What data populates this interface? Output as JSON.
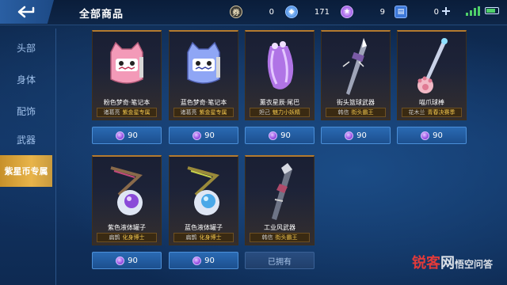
{
  "header": {
    "title": "全部商品",
    "currencies": [
      {
        "name": "coupon",
        "icon": "ticket-icon",
        "value": "0",
        "color": "#d9c8a0"
      },
      {
        "name": "diamond",
        "icon": "diamond-icon",
        "value": "171",
        "color": "#6aa8ff"
      },
      {
        "name": "purple-star",
        "icon": "purple-star-coin-icon",
        "value": "9",
        "color": "#b56dff"
      },
      {
        "name": "voucher",
        "icon": "voucher-icon",
        "value": "0",
        "color": "#4f8ef0"
      }
    ]
  },
  "sidebar": {
    "items": [
      {
        "label": "头部",
        "active": false
      },
      {
        "label": "身体",
        "active": false
      },
      {
        "label": "配饰",
        "active": false
      },
      {
        "label": "武器",
        "active": false
      },
      {
        "label": "紫星币专属",
        "active": true
      }
    ]
  },
  "products": [
    {
      "name": "粉色梦奇·笔记本",
      "hero": "诸葛亮",
      "tag": "紫金星专属",
      "price": "90",
      "owned": false,
      "art": "pink-notebook"
    },
    {
      "name": "蓝色梦奇·笔记本",
      "hero": "诸葛亮",
      "tag": "紫金星专属",
      "price": "90",
      "owned": false,
      "art": "blue-notebook"
    },
    {
      "name": "薰衣星辰·尾巴",
      "hero": "妲己",
      "tag": "魅力小妖精",
      "price": "90",
      "owned": false,
      "art": "lavender-tail"
    },
    {
      "name": "街头篮球武器",
      "hero": "韩信",
      "tag": "街头霸王",
      "price": "90",
      "owned": false,
      "art": "street-spear"
    },
    {
      "name": "喵爪球棒",
      "hero": "花木兰",
      "tag": "青春决赛季",
      "price": "90",
      "owned": false,
      "art": "cat-paw-bat"
    },
    {
      "name": "紫色液体罐子",
      "hero": "扁鹊",
      "tag": "化身博士",
      "price": "90",
      "owned": false,
      "art": "purple-jar"
    },
    {
      "name": "蓝色液体罐子",
      "hero": "扁鹊",
      "tag": "化身博士",
      "price": "90",
      "owned": false,
      "art": "blue-jar"
    },
    {
      "name": "工业风武器",
      "hero": "韩信",
      "tag": "街头霸王",
      "price": "已拥有",
      "owned": true,
      "art": "industrial-spear"
    }
  ],
  "watermark": {
    "red": "锐客",
    "white": "网",
    "suffix": "悟空问答"
  }
}
